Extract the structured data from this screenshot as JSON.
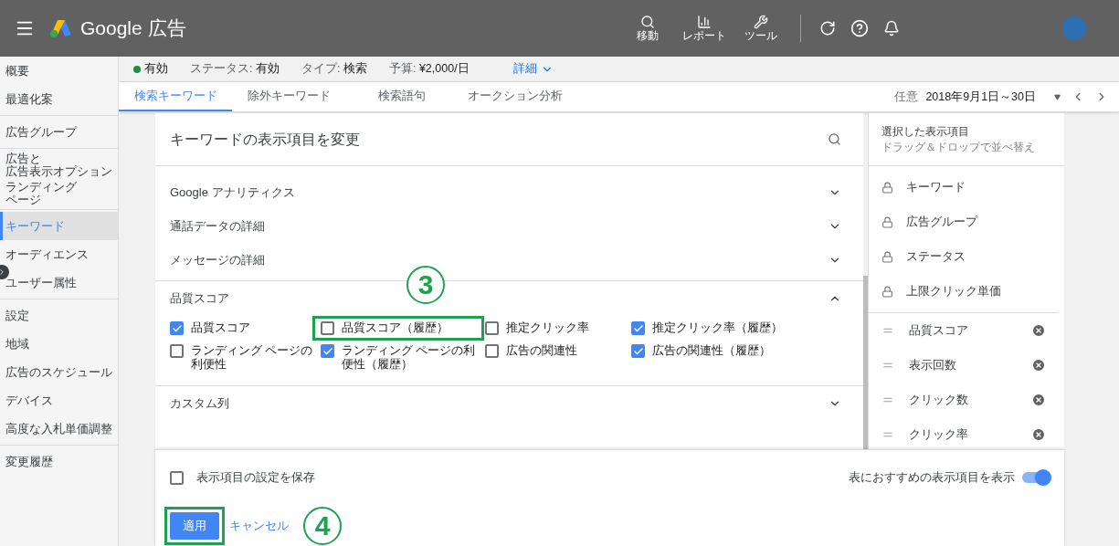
{
  "header": {
    "product": "Google 広告",
    "tools": [
      {
        "kind": "search",
        "label": "移動"
      },
      {
        "kind": "report",
        "label": "レポート"
      },
      {
        "kind": "tool",
        "label": "ツール"
      }
    ]
  },
  "sidebar": {
    "groups": [
      [
        {
          "label": "概要",
          "selected": false
        },
        {
          "label": "最適化案",
          "selected": false
        }
      ],
      [
        {
          "label": "広告グループ",
          "selected": false
        }
      ],
      [
        {
          "lines": [
            "広告と",
            "広告表示オプション"
          ],
          "selected": false
        },
        {
          "lines": [
            "ランディング",
            "ページ"
          ],
          "selected": false
        }
      ],
      [
        {
          "label": "キーワード",
          "selected": true
        },
        {
          "label": "オーディエンス",
          "selected": false
        },
        {
          "label": "ユーザー属性",
          "selected": false
        }
      ],
      [
        {
          "label": "設定",
          "selected": false
        },
        {
          "label": "地域",
          "selected": false
        },
        {
          "label": "広告のスケジュール",
          "selected": false
        },
        {
          "label": "デバイス",
          "selected": false
        },
        {
          "label": "高度な入札単価調整",
          "selected": false
        }
      ],
      [
        {
          "label": "変更履歴",
          "selected": false
        }
      ]
    ]
  },
  "status_bar": {
    "status": "有効",
    "active": true,
    "items": [
      {
        "label": "ステータス:",
        "value": "有効"
      },
      {
        "label": "タイプ:",
        "value": "検索"
      },
      {
        "label": "予算:",
        "value": "¥2,000/日"
      }
    ],
    "details_link": "詳細"
  },
  "tabs": [
    {
      "label": "検索キーワード",
      "selected": true
    },
    {
      "label": "除外キーワード",
      "selected": false
    },
    {
      "label": "検索語句",
      "selected": false
    },
    {
      "label": "オークション分析",
      "selected": false
    }
  ],
  "date_range": {
    "label": "任意",
    "value": "2018年9月1日～30日"
  },
  "dialog": {
    "title": "キーワードの表示項目を変更",
    "sections": [
      {
        "title": "Google アナリティクス",
        "expanded": false
      },
      {
        "title": "通話データの詳細",
        "expanded": false
      },
      {
        "title": "メッセージの詳細",
        "expanded": false
      },
      {
        "title": "品質スコア",
        "expanded": true,
        "options": [
          {
            "label": "品質スコア",
            "checked": true
          },
          {
            "label": "品質スコア（履歴）",
            "checked": false,
            "callout": "3"
          },
          {
            "label": "推定クリック率",
            "checked": false
          },
          {
            "label": "推定クリック率（履歴）",
            "checked": true
          },
          {
            "label": "ランディング ページの利便性",
            "checked": false
          },
          {
            "label": "ランディング ページの利便性（履歴）",
            "checked": true
          },
          {
            "label": "広告の関連性",
            "checked": false
          },
          {
            "label": "広告の関連性（履歴）",
            "checked": true
          }
        ]
      },
      {
        "title": "カスタム列",
        "expanded": false
      }
    ]
  },
  "selected_panel": {
    "title": "選択した表示項目",
    "subtitle": "ドラッグ＆ドロップで並べ替え",
    "locked": [
      "キーワード",
      "広告グループ",
      "ステータス",
      "上限クリック単価"
    ],
    "removable": [
      "品質スコア",
      "表示回数",
      "クリック数",
      "クリック率"
    ]
  },
  "footer": {
    "save": {
      "label": "表示項目の設定を保存",
      "checked": false
    },
    "recommend": {
      "label": "表におすすめの表示項目を表示",
      "on": true
    },
    "apply": {
      "label": "適用",
      "callout": "4"
    },
    "cancel": "キャンセル"
  }
}
